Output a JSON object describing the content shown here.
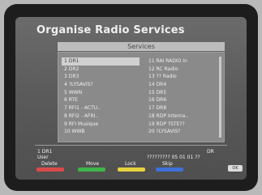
{
  "title": "Organise Radio Services",
  "tab": "Services",
  "services_left": [
    "1 DR1",
    "2 DR2",
    "3 DR3",
    "4 ?LYSAVIS?",
    "5 WWN",
    "6 RTE",
    "7 RFI1 - ACTU..",
    "8 RFI2 - AFRI..",
    "9 RFI Musique",
    "10 WWB"
  ],
  "services_right": [
    "11 RAI RADIO In",
    "12 RC Radio",
    "13 ?? Radio",
    "14 DR4",
    "15 DR5",
    "16 DR6",
    "17 DR8",
    "18 RDP Interna..",
    "19 RDP ?STE??",
    "20 ?LYSAVIS?"
  ],
  "selected_index": 0,
  "footer": {
    "left_top": "1 DR1",
    "left_bottom": "User",
    "right_top": "DR",
    "right_bottom": "????????? 05 01 01 ??"
  },
  "buttons": [
    {
      "label": "Delete",
      "color": "#d94b4b"
    },
    {
      "label": "Move",
      "color": "#3fb64a"
    },
    {
      "label": "Lock",
      "color": "#e4d23c"
    },
    {
      "label": "Skip",
      "color": "#3e71d6"
    }
  ],
  "corner_badge": "OK"
}
